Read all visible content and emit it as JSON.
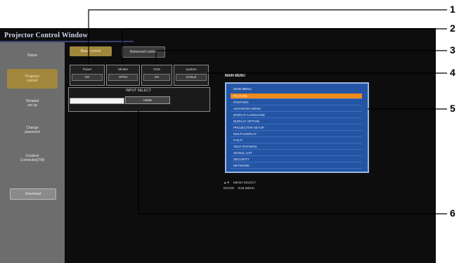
{
  "window": {
    "title": "Projector Control Window"
  },
  "sidebar": {
    "items": [
      {
        "line1": "Status",
        "line2": ""
      },
      {
        "line1": "Projector",
        "line2": "control"
      },
      {
        "line1": "Detailed",
        "line2": "set up"
      },
      {
        "line1": "Change",
        "line2": "password"
      },
      {
        "line1": "Crestron",
        "line2": "Connected(TM)"
      }
    ],
    "button_label": "Download"
  },
  "tabs": [
    {
      "label": "Basic control"
    },
    {
      "label": "Advanced control"
    }
  ],
  "status": [
    {
      "label": "Power",
      "value": "ON"
    },
    {
      "label": "Shutter",
      "value": "OPEN"
    },
    {
      "label": "OSD",
      "value": "ON"
    },
    {
      "label": "System",
      "value": "Default"
    }
  ],
  "input": {
    "title": "INPUT SELECT",
    "value": "HDMI"
  },
  "menu": {
    "heading": "MAIN MENU",
    "header_item": "MAIN MENU",
    "items": [
      "PICTURE",
      "POSITION",
      "ADVANCED MENU",
      "DISPLAY LANGUAGE",
      "DISPLAY OPTION",
      "PROJECTOR SETUP",
      "MULTI DISPLAY",
      "P IN P",
      "TEST PATTERN",
      "SIGNAL LIST",
      "SECURITY",
      "NETWORK"
    ],
    "selected_index": 0
  },
  "nav_hints": {
    "line1": {
      "key": "▲▼",
      "action": "MENU SELECT"
    },
    "line2": {
      "key": "ENTER",
      "action": "SUB MENU"
    }
  },
  "callouts": [
    "1",
    "2",
    "3",
    "4",
    "5",
    "6"
  ],
  "colors": {
    "accent_gold": "#a0873c",
    "menu_blue": "#2455a5",
    "menu_selected": "#f08a1c",
    "sidebar_gray": "#6d6d6d"
  }
}
